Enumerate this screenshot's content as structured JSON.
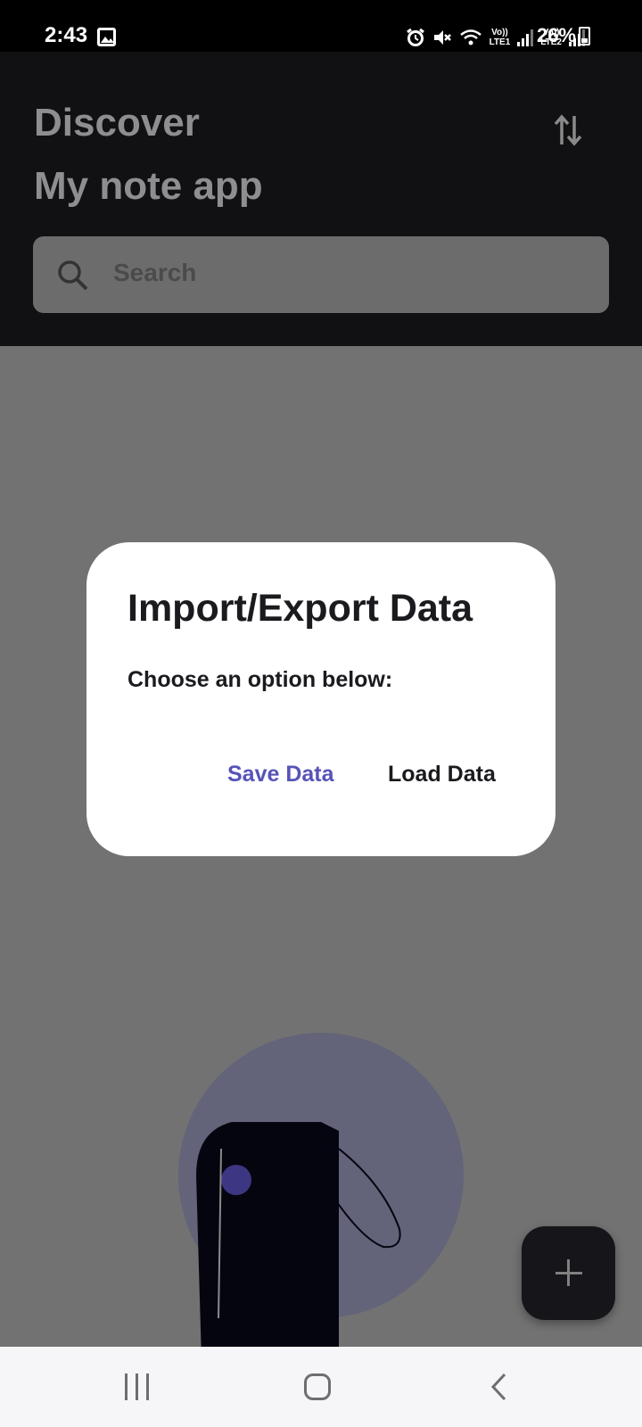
{
  "status_bar": {
    "time": "2:43",
    "lte1_top": "Vo))",
    "lte1_bottom": "LTE1",
    "lte2_top": "Vo))",
    "lte2_bottom": "LTE2",
    "battery": "26%"
  },
  "header": {
    "title": "Discover",
    "subtitle": "My note app",
    "search_placeholder": "Search"
  },
  "dialog": {
    "title": "Import/Export Data",
    "message": "Choose an option below:",
    "save_label": "Save Data",
    "load_label": "Load Data"
  },
  "colors": {
    "accent": "#5753b9",
    "header_bg": "#111114",
    "scrim": "#727272"
  }
}
